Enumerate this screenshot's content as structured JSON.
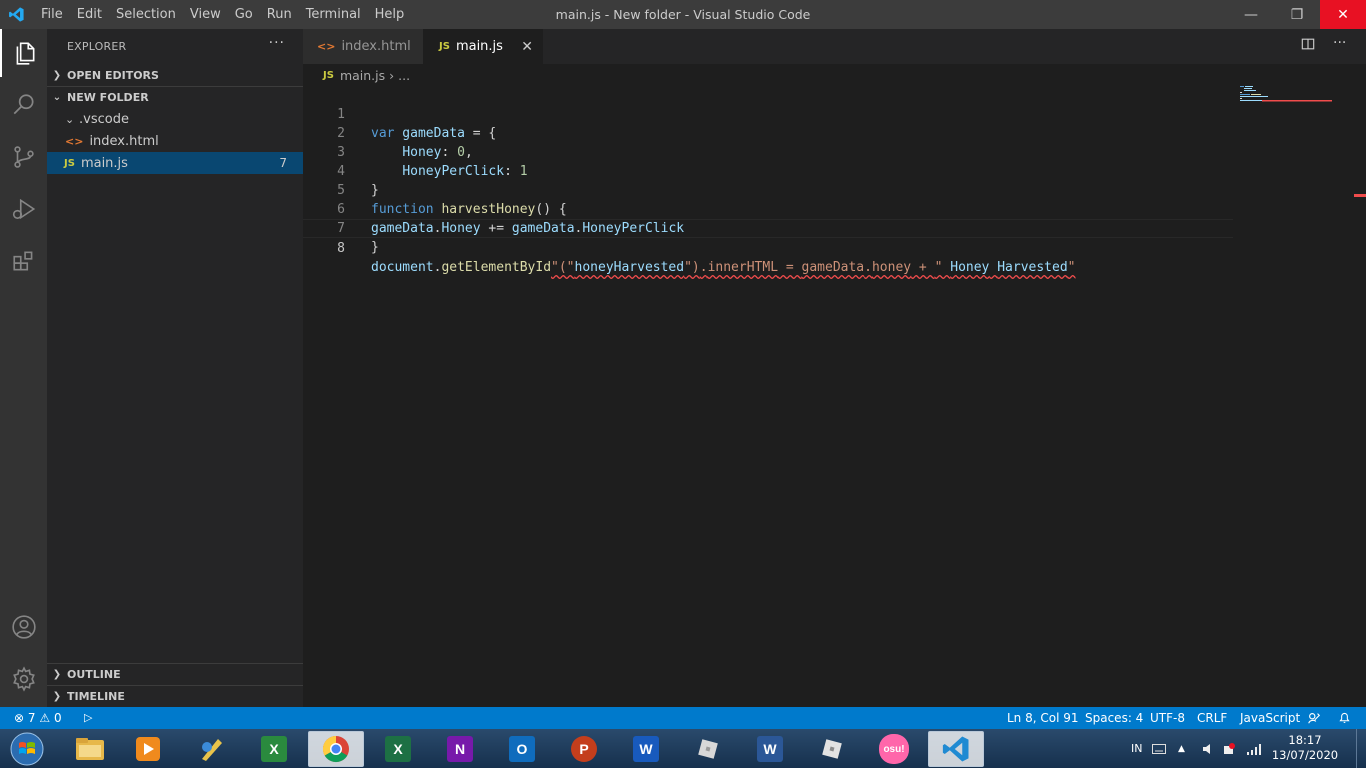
{
  "window": {
    "title": "main.js - New folder - Visual Studio Code",
    "menu": [
      "File",
      "Edit",
      "Selection",
      "View",
      "Go",
      "Run",
      "Terminal",
      "Help"
    ],
    "controls": {
      "minimize": "—",
      "maximize": "❐",
      "close": "✕"
    }
  },
  "activity_bar": {
    "items": [
      "explorer-icon",
      "search-icon",
      "source-control-icon",
      "run-debug-icon",
      "extensions-icon"
    ],
    "bottom": [
      "accounts-icon",
      "manage-gear-icon"
    ]
  },
  "sidebar": {
    "header": "EXPLORER",
    "more": "···",
    "open_editors": "OPEN EDITORS",
    "folder": "NEW FOLDER",
    "items": [
      {
        "label": ".vscode",
        "icon": "›"
      },
      {
        "label": "index.html",
        "icon": "<>"
      },
      {
        "label": "main.js",
        "icon": "JS",
        "badge": "7"
      }
    ],
    "outline": "OUTLINE",
    "timeline": "TIMELINE"
  },
  "tabs": [
    {
      "label": "index.html",
      "icon": "<>"
    },
    {
      "label": "main.js",
      "icon": "JS",
      "close": "✕"
    }
  ],
  "breadcrumb": {
    "icon": "JS",
    "file": "main.js",
    "sep": "›",
    "rest": "..."
  },
  "editor": {
    "line_numbers": [
      "1",
      "2",
      "3",
      "4",
      "5",
      "6",
      "7",
      "8"
    ],
    "lines": {
      "l1": {
        "kw": "var",
        "name": " gameData",
        "rest": " = {"
      },
      "l2": {
        "indent": "    ",
        "key": "Honey",
        "colon": ": ",
        "val": "0",
        "tail": ","
      },
      "l3": {
        "indent": "    ",
        "key": "HoneyPerClick",
        "colon": ": ",
        "val": "1"
      },
      "l4": {
        "text": "}"
      },
      "l5": {
        "kw": "function",
        "sp": " ",
        "fn": "harvestHoney",
        "rest": "() {"
      },
      "l6": {
        "a": "gameData",
        "d1": ".",
        "b": "Honey",
        "op": " += ",
        "c": "gameData",
        "d2": ".",
        "e": "HoneyPerClick"
      },
      "l7": {
        "text": "}"
      },
      "l8": {
        "obj": "document",
        "d1": ".",
        "fn": "getElementById",
        "s1": "\"(\"",
        "s2": "honeyHarvested",
        "s3": "\")",
        "d2": ".",
        "p1": "innerHTML",
        "op1": " = ",
        "o2": "gameData",
        "d3": ".",
        "p2": "honey",
        "op2": " + ",
        "s4": "\" ",
        "w1": "Honey",
        "sp": " ",
        "w2": "Harvested",
        "s5": "\""
      }
    }
  },
  "status_bar": {
    "errors": "7",
    "warnings": "0",
    "position": "Ln 8, Col 91",
    "spaces": "Spaces: 4",
    "encoding": "UTF-8",
    "eol": "CRLF",
    "language": "JavaScript"
  },
  "taskbar": {
    "apps": [
      "windows-start-icon",
      "file-explorer-icon",
      "media-player-icon",
      "paint-tool-icon",
      "excel-legacy-icon",
      "chrome-icon",
      "excel-icon",
      "onenote-icon",
      "outlook-icon",
      "powerpoint-icon",
      "word-icon",
      "roblox-icon",
      "word-legacy-icon",
      "roblox-studio-icon",
      "osu-icon",
      "vscode-icon"
    ],
    "labels": {
      "excel": "X",
      "excel2": "X",
      "onenote": "N",
      "outlook": "O",
      "powerpoint": "P",
      "word": "W",
      "word2": "W",
      "osu": "osu!"
    },
    "lang": "IN",
    "time": "18:17",
    "date": "13/07/2020"
  },
  "colors": {
    "accent": "#007acc",
    "sidebar_selected": "#094771",
    "close_red": "#e81123",
    "error": "#f14c4c"
  }
}
